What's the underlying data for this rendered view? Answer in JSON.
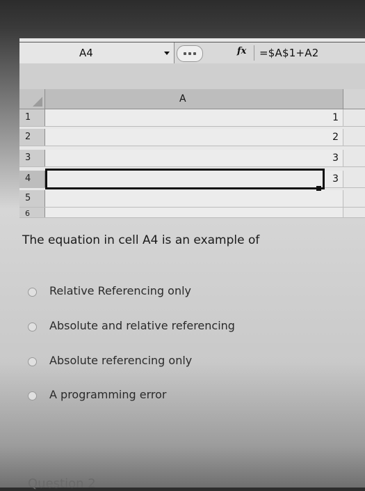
{
  "formula_bar": {
    "name_box": "A4",
    "fx_label": "fx",
    "formula": "=$A$1+A2"
  },
  "grid": {
    "column_headers": [
      "A"
    ],
    "rows": [
      {
        "header": "1",
        "value": "1"
      },
      {
        "header": "2",
        "value": "2"
      },
      {
        "header": "3",
        "value": "3"
      },
      {
        "header": "4",
        "value": "3"
      },
      {
        "header": "5",
        "value": ""
      },
      {
        "header": "6",
        "value": ""
      }
    ],
    "active_cell": "A4"
  },
  "question": {
    "text": "The equation in cell A4 is an example of",
    "options": [
      "Relative Referencing only",
      "Absolute and relative referencing",
      "Absolute referencing only",
      "A programming error"
    ]
  },
  "footer": {
    "next_label": "Question 2"
  },
  "colors": {
    "grid_bg": "#ececec",
    "active_border": "#111111"
  }
}
